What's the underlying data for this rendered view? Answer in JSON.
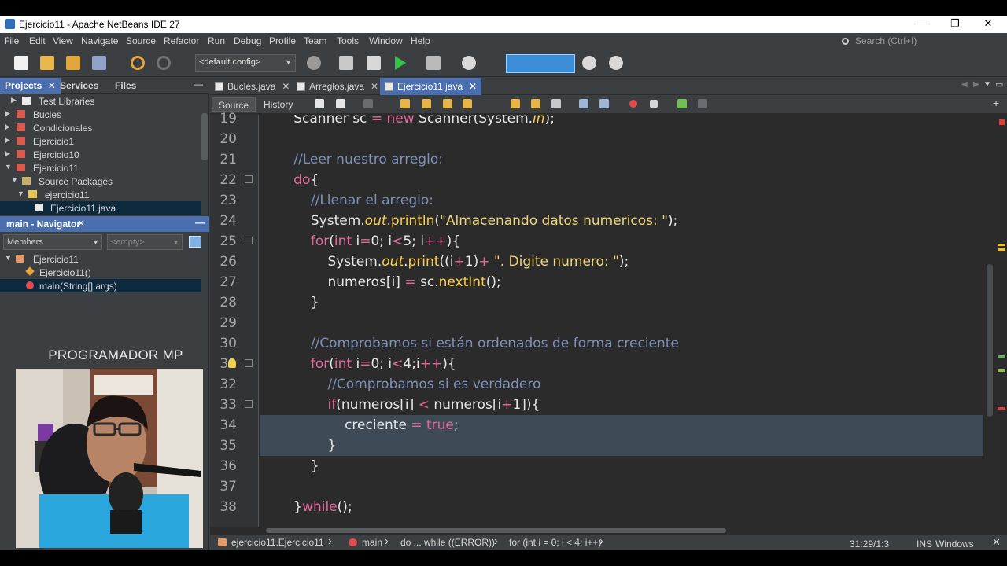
{
  "window": {
    "title": "Ejercicio11 - Apache NetBeans IDE 27"
  },
  "menu": [
    "File",
    "Edit",
    "View",
    "Navigate",
    "Source",
    "Refactor",
    "Run",
    "Debug",
    "Profile",
    "Team",
    "Tools",
    "Window",
    "Help"
  ],
  "search": {
    "placeholder": "Search (Ctrl+I)"
  },
  "toolbar": {
    "config": "<default config>"
  },
  "panel_tabs": [
    "Projects",
    "Services",
    "Files"
  ],
  "project_tree": [
    {
      "label": "Test Libraries",
      "indent": 1
    },
    {
      "label": "Bucles",
      "indent": 0
    },
    {
      "label": "Condicionales",
      "indent": 0
    },
    {
      "label": "Ejercicio1",
      "indent": 0
    },
    {
      "label": "Ejercicio10",
      "indent": 0
    },
    {
      "label": "Ejercicio11",
      "indent": 0
    },
    {
      "label": "Source Packages",
      "indent": 1
    },
    {
      "label": "ejercicio11",
      "indent": 2
    },
    {
      "label": "Ejercicio11.java",
      "indent": 3
    }
  ],
  "navigator": {
    "title": "main - Navigator",
    "filter": "Members",
    "empty": "<empty>",
    "items": [
      "Ejercicio11",
      "Ejercicio11()",
      "main(String[] args)"
    ]
  },
  "webcam": {
    "label": "PROGRAMADOR MP"
  },
  "file_tabs": [
    "Bucles.java",
    "Arreglos.java",
    "Ejercicio11.java"
  ],
  "editor_modes": [
    "Source",
    "History"
  ],
  "code_lines": [
    {
      "n": "19",
      "t": "        Scanner sc = new Scanner(System.in);"
    },
    {
      "n": "20",
      "t": ""
    },
    {
      "n": "21",
      "t": "        //Leer nuestro arreglo:"
    },
    {
      "n": "22",
      "t": "        do{"
    },
    {
      "n": "23",
      "t": "            //Llenar el arreglo:"
    },
    {
      "n": "24",
      "t": "            System.out.println(\"Almacenando datos numericos: \");"
    },
    {
      "n": "25",
      "t": "            for(int i=0; i<5; i++){"
    },
    {
      "n": "26",
      "t": "                System.out.print((i+1)+ \". Digite numero: \");"
    },
    {
      "n": "27",
      "t": "                numeros[i] = sc.nextInt();"
    },
    {
      "n": "28",
      "t": "            }"
    },
    {
      "n": "29",
      "t": ""
    },
    {
      "n": "30",
      "t": "            //Comprobamos si están ordenados de forma creciente"
    },
    {
      "n": "31",
      "t": "            for(int i=0; i<4;i++){"
    },
    {
      "n": "32",
      "t": "                //Comprobamos si es verdadero"
    },
    {
      "n": "33",
      "t": "                if(numeros[i] < numeros[i+1]){"
    },
    {
      "n": "34",
      "t": "                    creciente = true;"
    },
    {
      "n": "35",
      "t": "                }"
    },
    {
      "n": "36",
      "t": "            }"
    },
    {
      "n": "37",
      "t": ""
    },
    {
      "n": "38",
      "t": "        }while();"
    }
  ],
  "breadcrumbs": [
    "ejercicio11.Ejercicio11",
    "main",
    "do ... while ((ERROR))",
    "for (int i = 0; i < 4; i++)"
  ],
  "status": {
    "position": "31:29/1:3",
    "mode": "INS",
    "line_endings": "Windows (CRLF)"
  }
}
